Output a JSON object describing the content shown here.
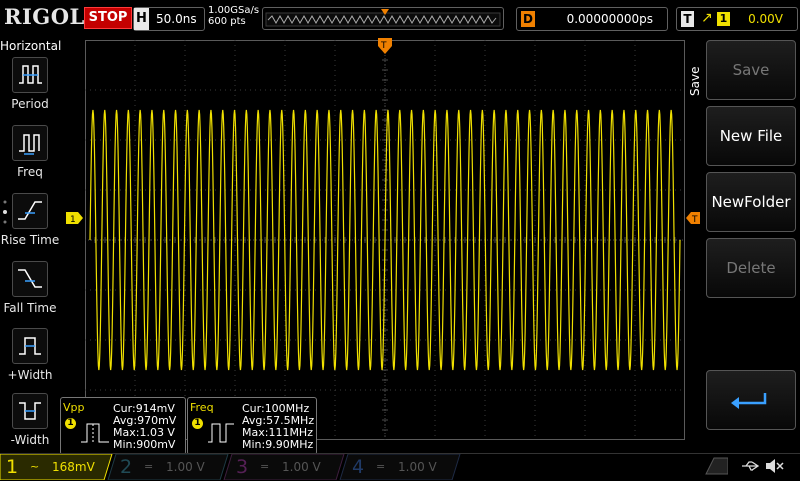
{
  "topbar": {
    "logo": "RIGOL",
    "run_state": "STOP",
    "horizontal": {
      "label": "H",
      "timebase": "50.0ns"
    },
    "sample_rate": "1.00GSa/s",
    "memory_depth": "600 pts",
    "delay": {
      "label": "D",
      "value": "0.00000000ps"
    },
    "trigger": {
      "label": "T",
      "channel": "1",
      "level": "0.00V"
    }
  },
  "left_menu": {
    "title": "Horizontal",
    "items": [
      {
        "label": "Period",
        "icon": "period-icon"
      },
      {
        "label": "Freq",
        "icon": "frequency-icon"
      },
      {
        "label": "Rise Time",
        "icon": "rise-time-icon"
      },
      {
        "label": "Fall Time",
        "icon": "fall-time-icon"
      },
      {
        "label": "+Width",
        "icon": "positive-width-icon"
      },
      {
        "label": "-Width",
        "icon": "negative-width-icon"
      }
    ]
  },
  "right_menu": {
    "title": "Save",
    "buttons": [
      {
        "label": "Save",
        "enabled": false
      },
      {
        "label": "New File",
        "enabled": true
      },
      {
        "label": "NewFolder",
        "enabled": true
      },
      {
        "label": "Delete",
        "enabled": false
      },
      {
        "label": "",
        "icon": "enter-icon",
        "enabled": true
      }
    ]
  },
  "waveform": {
    "channel": "1",
    "color": "#f0e000",
    "cycles": 50,
    "amplitude_fraction": 0.65,
    "trigger_marker": "T"
  },
  "measurements": [
    {
      "name": "Vpp",
      "channel": "1",
      "cur": "Cur:914mV",
      "avg": "Avg:970mV",
      "max": "Max:1.03 V",
      "min": "Min:900mV"
    },
    {
      "name": "Freq",
      "channel": "1",
      "cur": "Cur:100MHz",
      "avg": "Avg:57.5MHz",
      "max": "Max:111MHz",
      "min": "Min:9.90MHz"
    }
  ],
  "channels": [
    {
      "number": "1",
      "coupling": "~",
      "scale": "168mV",
      "color": "#f0e000",
      "active": true
    },
    {
      "number": "2",
      "coupling": "=",
      "scale": "1.00 V",
      "color": "#00c8ff",
      "active": false
    },
    {
      "number": "3",
      "coupling": "=",
      "scale": "1.00 V",
      "color": "#ff00ff",
      "active": false
    },
    {
      "number": "4",
      "coupling": "=",
      "scale": "1.00 V",
      "color": "#1a6cff",
      "active": false
    }
  ],
  "status_icons": [
    "usb-icon",
    "speaker-muted-icon"
  ],
  "colors": {
    "ch1": "#f0e000",
    "accent": "#f08000",
    "stop": "#c40000"
  }
}
